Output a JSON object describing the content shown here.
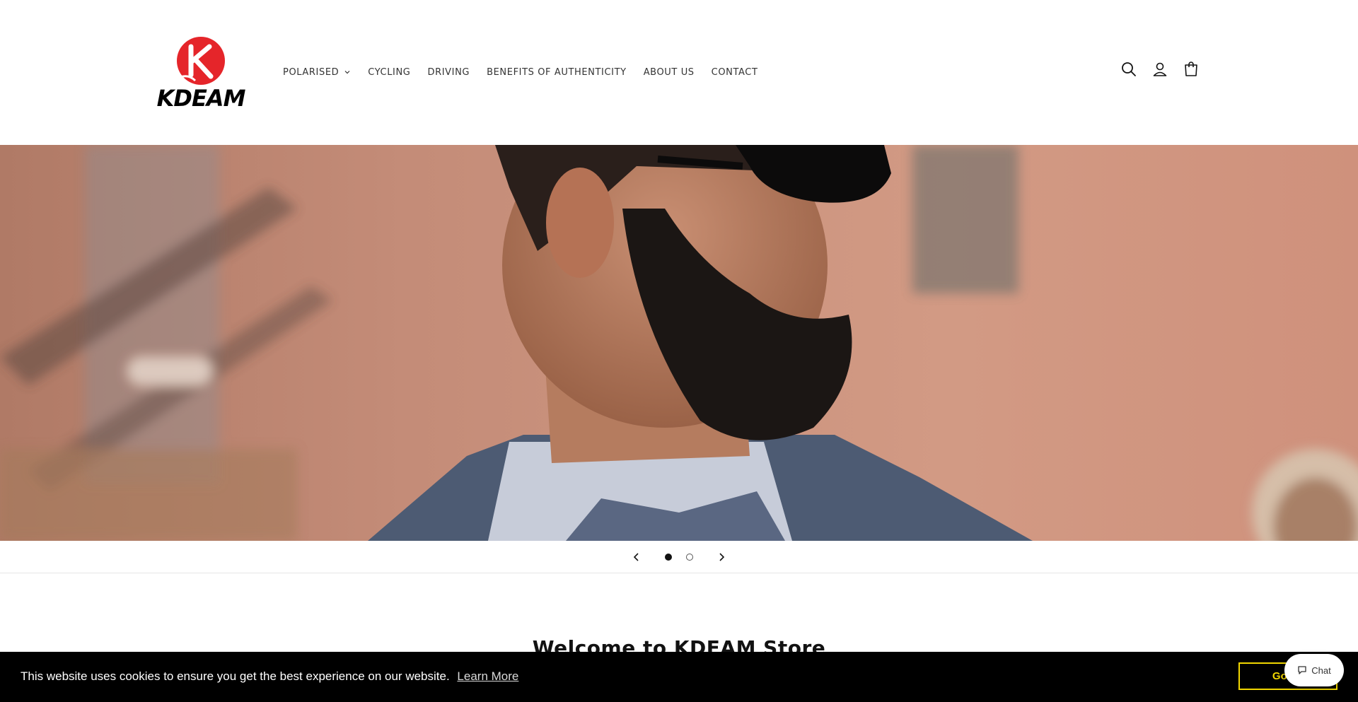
{
  "brand": {
    "name": "KDEAM",
    "accent": "#e5252a"
  },
  "nav": {
    "items": [
      {
        "label": "POLARISED",
        "has_dropdown": true
      },
      {
        "label": "CYCLING"
      },
      {
        "label": "DRIVING"
      },
      {
        "label": "BENEFITS OF AUTHENTICITY"
      },
      {
        "label": "ABOUT US"
      },
      {
        "label": "CONTACT"
      }
    ]
  },
  "header_icons": [
    "search-icon",
    "account-icon",
    "cart-icon"
  ],
  "slider": {
    "current": 1,
    "total": 2
  },
  "welcome": {
    "title": "Welcome to KDEAM Store"
  },
  "cookie": {
    "message": "This website uses cookies to ensure you get the best experience on our website.",
    "learn_more": "Learn More",
    "button": "Got it!",
    "button_color": "#f1d600"
  },
  "chat": {
    "label": "Chat"
  }
}
